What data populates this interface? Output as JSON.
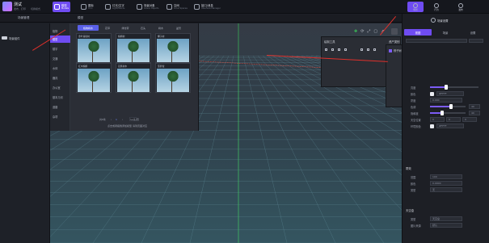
{
  "app": {
    "title": "测试",
    "subtitle": "发布、打印",
    "subtitle2": "切换模式"
  },
  "toolbar": [
    {
      "label": "模型",
      "sub": "Models",
      "active": true,
      "icon": "cube-icon"
    },
    {
      "label": "图标",
      "sub": "Icon",
      "active": false,
      "icon": "image-icon"
    },
    {
      "label": "灯光/文字",
      "sub": "Light/Words",
      "active": false,
      "icon": "bulb-icon"
    },
    {
      "label": "场景对象",
      "sub": "Scene Objects",
      "active": false,
      "icon": "object-icon"
    },
    {
      "label": "空间",
      "sub": "Local Spaces",
      "active": false,
      "icon": "space-icon"
    },
    {
      "label": "接口/消息",
      "sub": "Interface Manager",
      "active": false,
      "icon": "interface-icon"
    }
  ],
  "top_right": [
    {
      "label": "场景",
      "icon": "scene-icon",
      "active": true
    },
    {
      "label": "行为",
      "icon": "behavior-icon",
      "active": false
    },
    {
      "label": "发布",
      "icon": "publish-icon",
      "active": false
    }
  ],
  "secondary": {
    "left": "场景管理",
    "middle": "模型"
  },
  "scene_tree": {
    "item": "场景组件"
  },
  "categories": [
    "植物",
    "模型",
    "楼宇",
    "交通",
    "水体",
    "器具",
    "办公室",
    "基本几何",
    "道路",
    "杂项"
  ],
  "library": {
    "tabs": [
      "植物树木",
      "花草",
      "绿化带",
      "石头",
      "树木",
      "盆景"
    ],
    "thumbs": [
      "金叶菩提树",
      "棕榈树",
      "椰子树",
      "红木棕榈",
      "芭蕉树木",
      "菠萝蜜"
    ],
    "pager": {
      "prefix": "共6条",
      "page": "1",
      "page_size": "50条/页"
    },
    "hint": "点击或者拖拽添加模型 请到页面对应"
  },
  "tool_panel": {
    "title": "绘制工具"
  },
  "dropdown": {
    "title": "资产类别",
    "items": [
      "棕子树"
    ]
  },
  "right_panel": {
    "tabs": [
      "视图",
      "场景",
      "设置"
    ],
    "header": "场景设置",
    "props": [
      {
        "label": "亮度",
        "type": "slider",
        "value": 0.3
      },
      {
        "label": "颜色",
        "type": "color",
        "text": "#FFFF"
      },
      {
        "label": "雾度",
        "type": "input",
        "text": "0.000"
      },
      {
        "label": "色调",
        "type": "slider",
        "value": 0.55,
        "num": "40"
      },
      {
        "label": "饱和度",
        "type": "slider",
        "value": 0.3,
        "num": "40"
      },
      {
        "label": "天空位置",
        "type": "triple",
        "text": "0"
      },
      {
        "label": "环境颜色",
        "type": "color",
        "text": "#FFFF"
      }
    ],
    "section2": "雾效",
    "props2": [
      {
        "label": "范围",
        "text": "100"
      },
      {
        "label": "颜色",
        "text": "0.0000"
      },
      {
        "label": "类型",
        "text": "无"
      }
    ],
    "section3": "天空盒",
    "props3": [
      {
        "label": "类型",
        "text": "天空盒"
      },
      {
        "label": "图片来源",
        "text": "默认"
      }
    ]
  }
}
